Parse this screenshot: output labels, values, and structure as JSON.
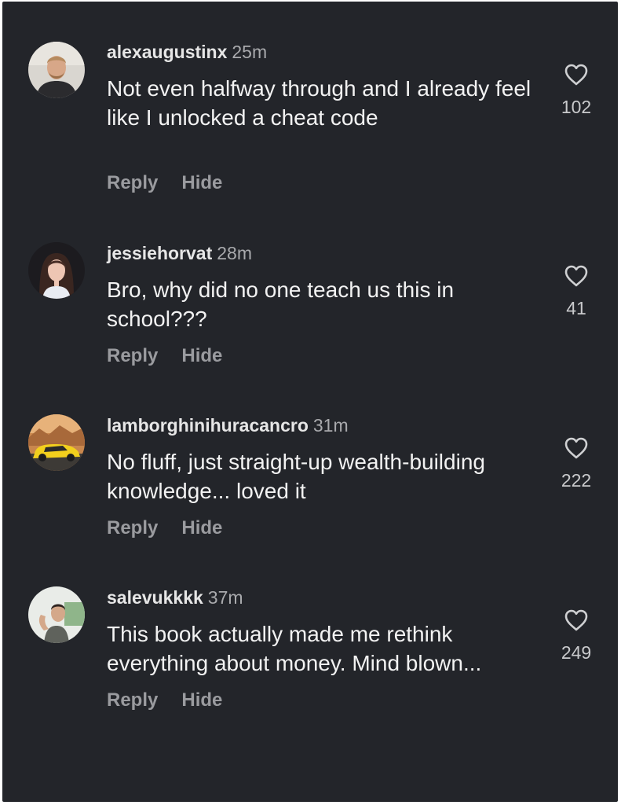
{
  "comments": [
    {
      "username": "alexaugustinx",
      "time": "25m",
      "text": "Not even halfway through and I already feel like I unlocked a cheat code",
      "reply_label": "Reply",
      "hide_label": "Hide",
      "likes": "102",
      "avatar": "man-portrait-avatar"
    },
    {
      "username": "jessiehorvat",
      "time": "28m",
      "text": "Bro, why did no one teach us this in school???",
      "reply_label": "Reply",
      "hide_label": "Hide",
      "likes": "41",
      "avatar": "woman-portrait-avatar"
    },
    {
      "username": "lamborghinihuracancro",
      "time": "31m",
      "text": "No fluff, just straight-up wealth-building knowledge... loved it",
      "reply_label": "Reply",
      "hide_label": "Hide",
      "likes": "222",
      "avatar": "yellow-sports-car-avatar"
    },
    {
      "username": "salevukkkk",
      "time": "37m",
      "text": "This book actually made me rethink everything about money. Mind blown...",
      "reply_label": "Reply",
      "hide_label": "Hide",
      "likes": "249",
      "avatar": "man-flexing-avatar"
    }
  ],
  "colors": {
    "background": "#23252a",
    "username": "#e6e6e6",
    "timestamp": "#a9aaad",
    "comment_text": "#f2f2f2",
    "action_text": "#9a9b9f",
    "like_count": "#c9cacc",
    "heart_outline": "#cfd0d2"
  }
}
